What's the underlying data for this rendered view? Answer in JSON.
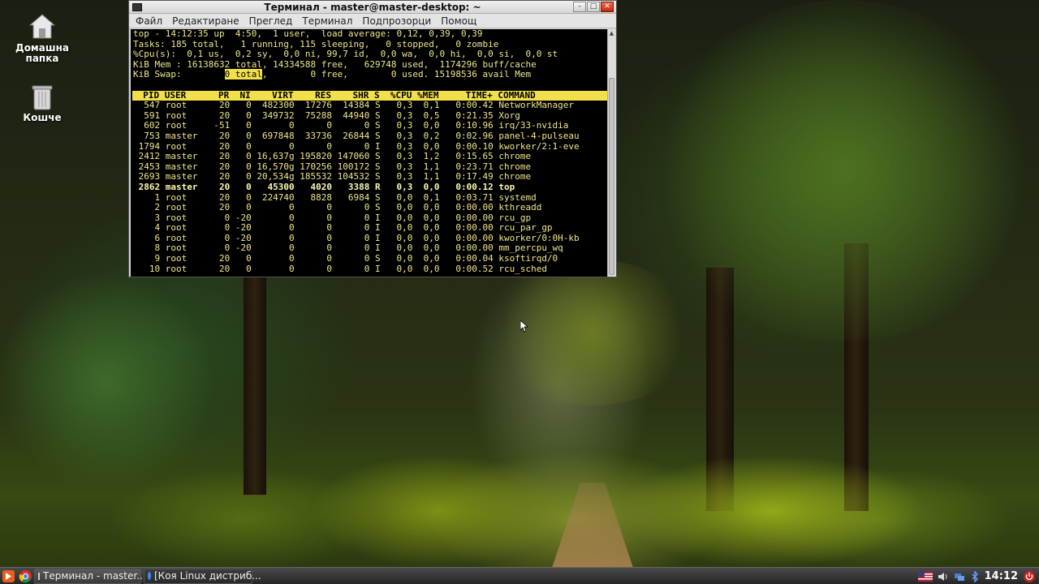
{
  "desktop": {
    "icons": [
      {
        "label": "Домашна\nпапка",
        "icon": "home-folder-icon"
      },
      {
        "label": "Кошче",
        "icon": "trash-icon"
      }
    ]
  },
  "window": {
    "title": "Терминал - master@master-desktop: ~",
    "menu": [
      "Файл",
      "Редактиране",
      "Преглед",
      "Терминал",
      "Подпрозорци",
      "Помощ"
    ]
  },
  "top": {
    "line1": "top - 14:12:35 up  4:50,  1 user,  load average: 0,12, 0,39, 0,39",
    "line2": "Tasks: 185 total,   1 running, 115 sleeping,   0 stopped,   0 zombie",
    "line3": "%Cpu(s):  0,1 us,  0,2 sy,  0,0 ni, 99,7 id,  0,0 wa,  0,0 hi,  0,0 si,  0,0 st",
    "line4": "KiB Mem : 16138632 total, 14334588 free,   629748 used,  1174296 buff/cache",
    "line5_a": "KiB Swap:        ",
    "line5_hl": "0 total",
    "line5_b": ",        0 free,        0 used. 15198536 avail Mem",
    "header": "  PID USER      PR  NI    VIRT    RES    SHR S  %CPU %MEM     TIME+ COMMAND",
    "rows": [
      "  547 root      20   0  482300  17276  14384 S   0,3  0,1   0:00.42 NetworkManager",
      "  591 root      20   0  349732  75288  44940 S   0,3  0,5   0:21.35 Xorg",
      "  602 root     -51   0       0      0      0 S   0,3  0,0   0:10.96 irq/33-nvidia",
      "  753 master    20   0  697848  33736  26844 S   0,3  0,2   0:02.96 panel-4-pulseau",
      " 1794 root      20   0       0      0      0 I   0,3  0,0   0:00.10 kworker/2:1-eve",
      " 2412 master    20   0 16,637g 195820 147060 S   0,3  1,2   0:15.65 chrome",
      " 2453 master    20   0 16,570g 170256 100172 S   0,3  1,1   0:23.71 chrome",
      " 2693 master    20   0 20,534g 185532 104532 S   0,3  1,1   0:17.49 chrome",
      " 2862 master    20   0   45300   4020   3388 R   0,3  0,0   0:00.12 top",
      "    1 root      20   0  224740   8828   6984 S   0,0  0,1   0:03.71 systemd",
      "    2 root      20   0       0      0      0 S   0,0  0,0   0:00.00 kthreadd",
      "    3 root       0 -20       0      0      0 I   0,0  0,0   0:00.00 rcu_gp",
      "    4 root       0 -20       0      0      0 I   0,0  0,0   0:00.00 rcu_par_gp",
      "    6 root       0 -20       0      0      0 I   0,0  0,0   0:00.00 kworker/0:0H-kb",
      "    8 root       0 -20       0      0      0 I   0,0  0,0   0:00.00 mm_percpu_wq",
      "    9 root      20   0       0      0      0 S   0,0  0,0   0:00.04 ksoftirqd/0",
      "   10 root      20   0       0      0      0 I   0,0  0,0   0:00.52 rcu_sched"
    ]
  },
  "taskbar": {
    "tasks": [
      "Терминал - master...",
      "[Коя Linux дистриб..."
    ],
    "clock": "14:12"
  }
}
